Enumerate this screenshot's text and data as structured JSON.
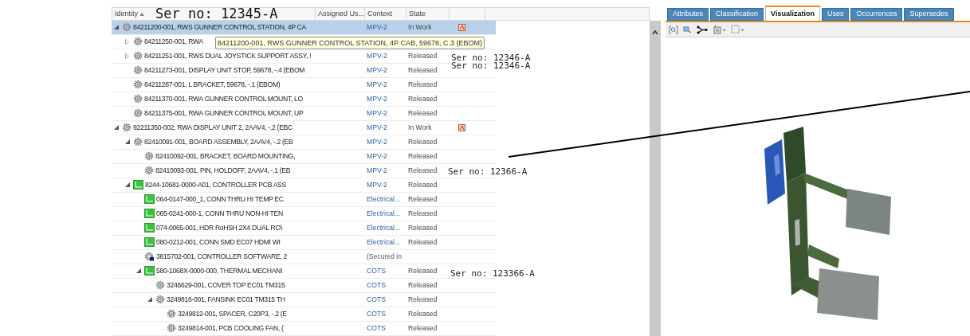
{
  "columns": [
    "Identity",
    "Assigned Us...",
    "Context",
    "State"
  ],
  "table": {
    "rows": [
      {
        "identity": "84211200-001, RWS GUNNER CONTROL STATION, 4P CA",
        "context": "MPV-2",
        "state": "In Work",
        "kind": "gear",
        "flag": true,
        "selected": true,
        "expanded": true,
        "children": [
          {
            "identity": "84211250-001, RWA",
            "kind": "gear",
            "flag": false,
            "selected": false,
            "expanded": false
          },
          {
            "identity": "84211251-001, RWS DUAL JOYSTICK SUPPORT ASSY, !",
            "context": "MPV-2",
            "state": "Released",
            "kind": "gear",
            "flag": false,
            "selected": false,
            "expanded": false
          },
          {
            "identity": "84211273-001, DISPLAY UNIT STOP, 59678, -.4 (EBOM",
            "context": "MPV-2",
            "state": "Released",
            "kind": "gear",
            "flag": false,
            "selected": false
          },
          {
            "identity": "84211287-001, L BRACKET, 59678, -.1 (EBOM)",
            "context": "MPV-2",
            "state": "Released",
            "kind": "gear",
            "flag": false,
            "selected": false
          },
          {
            "identity": "84211370-001, RWA GUNNER CONTROL MOUNT, LO",
            "context": "MPV-2",
            "state": "Released",
            "kind": "gear",
            "flag": false,
            "selected": false
          },
          {
            "identity": "84211375-001, RWA GUNNER CONTROL MOUNT, UP",
            "context": "MPV-2",
            "state": "Released",
            "kind": "gear",
            "flag": false,
            "selected": false
          }
        ]
      },
      {
        "identity": "92211350-002, RWA DISPLAY UNIT 2, 2AAV4, -.2 (EBC",
        "context": "MPV-2",
        "state": "In Work",
        "kind": "gear",
        "flag": true,
        "selected": false,
        "expanded": true,
        "children": [
          {
            "identity": "82410091-001, BOARD ASSEMBLY, 2AAV4, -.2 (EB",
            "context": "MPV-2",
            "state": "Released",
            "kind": "gear",
            "flag": false,
            "selected": false,
            "expanded": true,
            "children": [
              {
                "identity": "82410092-001, BRACKET, BOARD MOUNTING,",
                "context": "MPV-2",
                "state": "Released",
                "kind": "gear",
                "flag": false,
                "selected": false
              },
              {
                "identity": "82410093-001, PIN, HOLDOFF, 2AAV4, -.1 (EB",
                "context": "MPV-2",
                "state": "Released",
                "kind": "gear",
                "flag": false,
                "selected": false
              }
            ]
          },
          {
            "identity": "8244-10681-0000-A01, CONTROLLER PCB ASS",
            "context": "MPV-2",
            "state": "Released",
            "kind": "pcb",
            "flag": false,
            "selected": false,
            "expanded": true,
            "children": [
              {
                "identity": "064-0147-000_1, CONN THRU HI TEMP EC",
                "context": "Electrical...",
                "state": "Released",
                "kind": "pcb",
                "flag": false,
                "selected": false
              },
              {
                "identity": "065-0241-000-1, CONN THRU NON-HI TEN",
                "context": "Electrical...",
                "state": "Released",
                "kind": "pcb",
                "flag": false,
                "selected": false
              },
              {
                "identity": "074-0065-001, HDR RoHSH 2X4 DUAL RO\\",
                "context": "Electrical...",
                "state": "Released",
                "kind": "pcb",
                "flag": false,
                "selected": false
              },
              {
                "identity": "080-0212-001, CONN SMD EC07 HDMI WI",
                "context": "Electrical...",
                "state": "Released",
                "kind": "pcb",
                "flag": false,
                "selected": false
              },
              {
                "identity": "3815702-001, CONTROLLER SOFTWARE, 2",
                "context": "(Secured in",
                "kind": "secured",
                "flag": false,
                "selected": false
              },
              {
                "identity": "580-1068X-0000-000, THERMAL MECHANI",
                "context": "COTS",
                "state": "Released",
                "kind": "pcb",
                "flag": false,
                "selected": false,
                "expanded": true,
                "children": [
                  {
                    "identity": "3246629-001, COVER TOP EC01 TM315",
                    "context": "COTS",
                    "state": "Released",
                    "kind": "gear",
                    "flag": false,
                    "selected": false
                  },
                  {
                    "identity": "3249816-001, FANSINK EC01 TM315 TH",
                    "context": "COTS",
                    "state": "Released",
                    "kind": "gear",
                    "flag": false,
                    "selected": false,
                    "expanded": true,
                    "children": [
                      {
                        "identity": "3249812-001, SPACER, C20P3, -.2 (E",
                        "context": "COTS",
                        "state": "Released",
                        "kind": "gear",
                        "flag": false,
                        "selected": false
                      },
                      {
                        "identity": "3249814-001, PCB COOLING FAN, (",
                        "context": "COTS",
                        "state": "Released",
                        "kind": "gear",
                        "flag": false,
                        "selected": false
                      }
                    ]
                  }
                ]
              }
            ]
          }
        ]
      }
    ]
  },
  "tooltip_text": "84211200-001, RWS GUNNER CONTROL STATION, 4P CAB, 59678, C.3 (EBOM)",
  "annotations": [
    "Ser no: 12345-A",
    "Ser no: 12346-A",
    "Ser no: 12346-A",
    "Ser no: 12366-A",
    "Ser no: 123366-A"
  ],
  "tabs": [
    {
      "label": "Attributes",
      "selected": false
    },
    {
      "label": "Classification",
      "selected": false
    },
    {
      "label": "Visualization",
      "selected": true
    },
    {
      "label": "Uses",
      "selected": false
    },
    {
      "label": "Occurrences",
      "selected": false
    },
    {
      "label": "Supersedes",
      "selected": false
    }
  ]
}
